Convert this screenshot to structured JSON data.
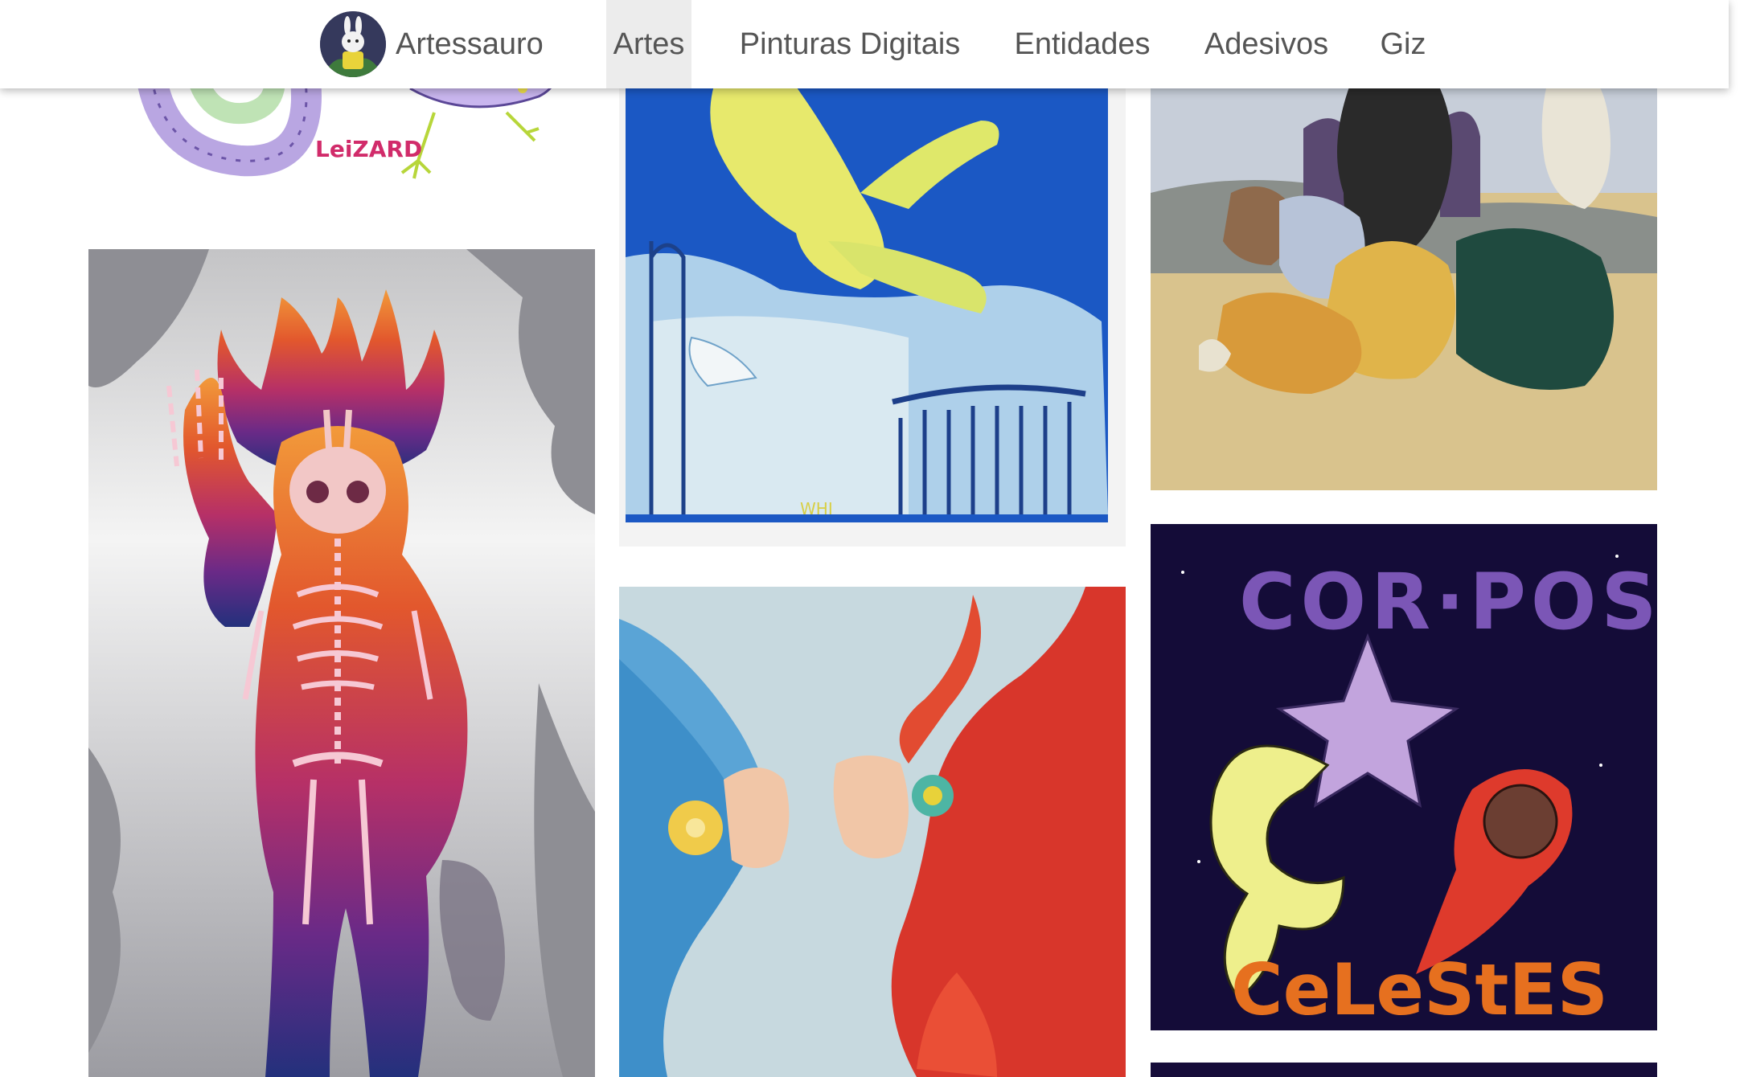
{
  "brand": {
    "name": "Artessauro",
    "logo_icon": "bunny-avatar-icon"
  },
  "nav": {
    "items": [
      {
        "label": "Artes",
        "active": true
      },
      {
        "label": "Pinturas Digitais",
        "active": false
      },
      {
        "label": "Entidades",
        "active": false
      },
      {
        "label": "Adesivos",
        "active": false
      },
      {
        "label": "Giz",
        "active": false
      }
    ]
  },
  "gallery": {
    "artworks": [
      {
        "name": "lizard-artwork",
        "caption_text": "LeiZARD"
      },
      {
        "name": "flaming-skeleton-artwork"
      },
      {
        "name": "pencil-figure-on-bed-artwork",
        "signature": "WHI"
      },
      {
        "name": "two-figures-facing-artwork"
      },
      {
        "name": "goat-gathering-painting-artwork"
      },
      {
        "name": "corpos-celestes-artwork",
        "title_top": "COR·POS",
        "title_bottom": "CeLeStES"
      },
      {
        "name": "dark-artwork-partial"
      }
    ]
  },
  "colors": {
    "nav_text": "#555555",
    "nav_active_bg": "#ececec",
    "page_bg": "#ffffff"
  }
}
